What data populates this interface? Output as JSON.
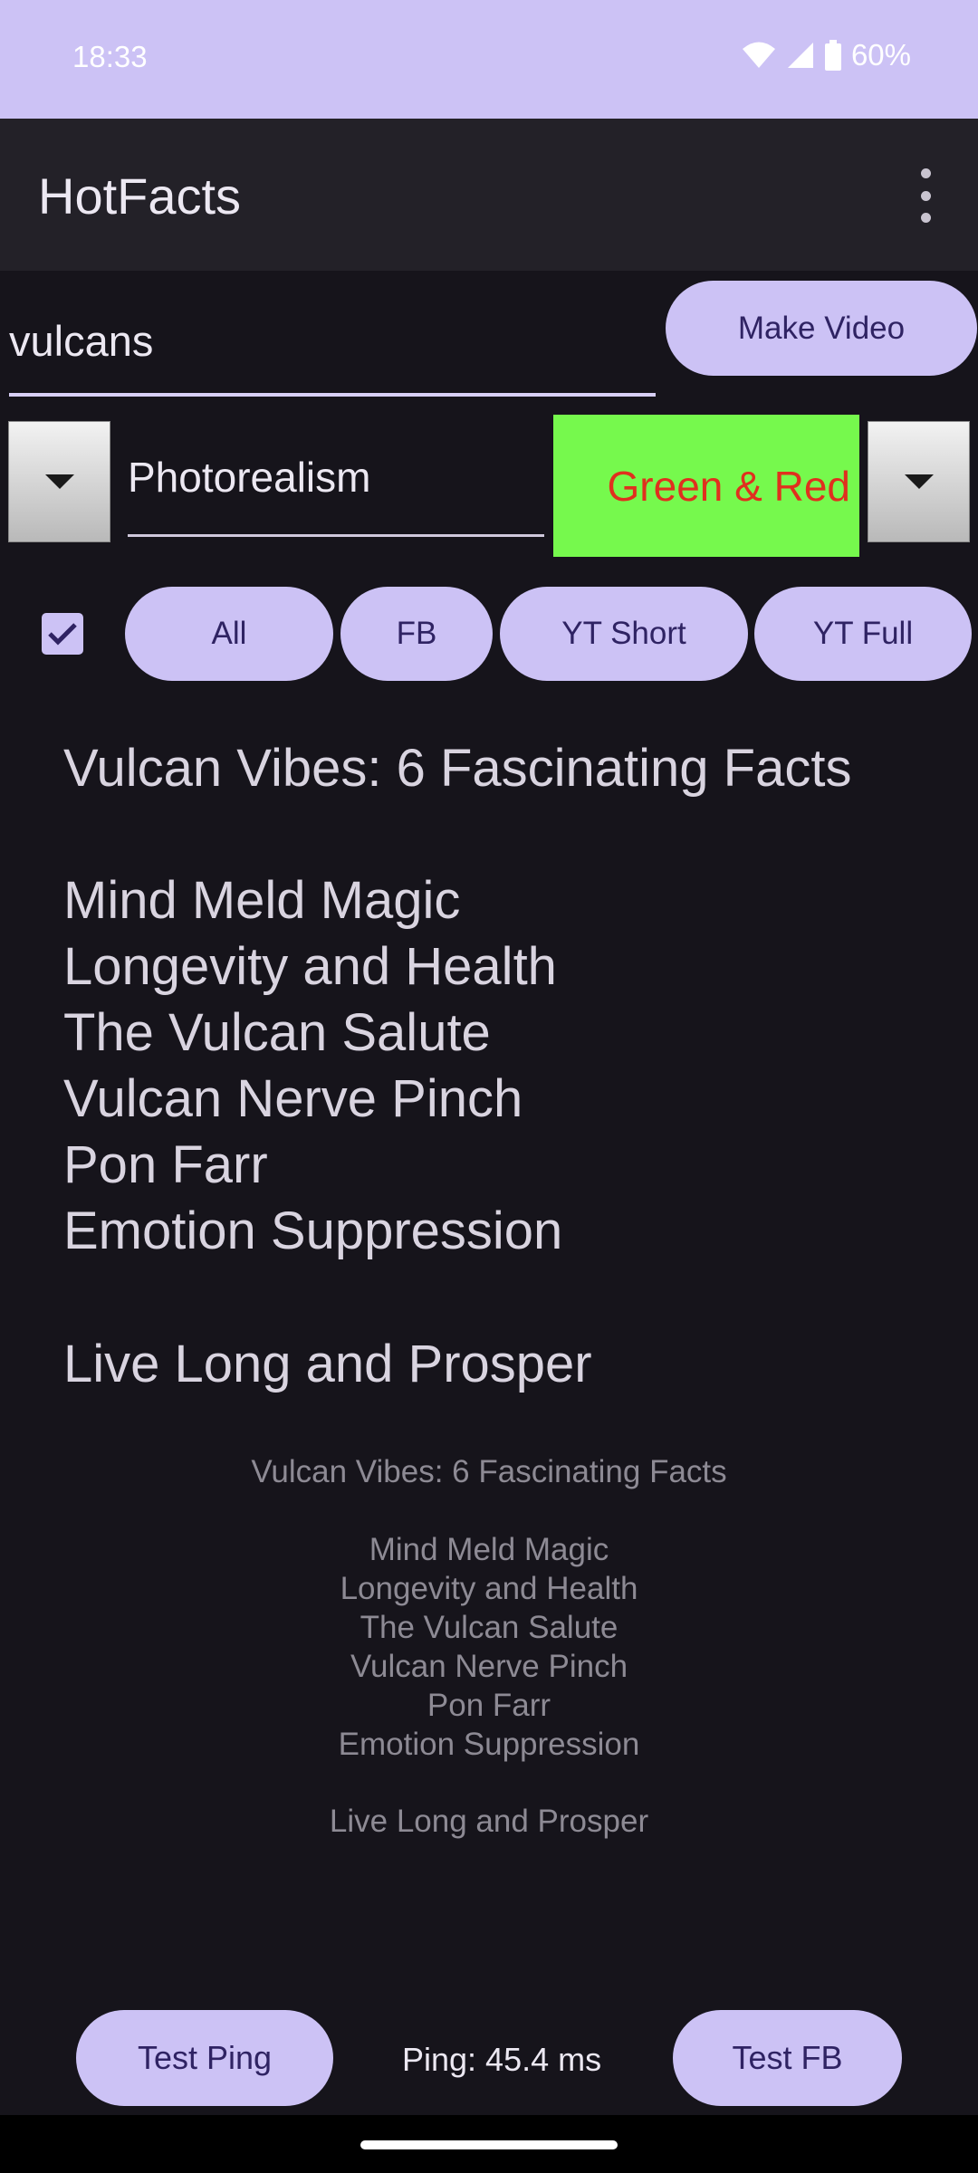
{
  "status_bar": {
    "time": "18:33",
    "battery": "60%"
  },
  "app_bar": {
    "title": "HotFacts"
  },
  "search": {
    "value": "vulcans",
    "make_video_label": "Make Video"
  },
  "style": {
    "field_value": "Photorealism",
    "color_scheme": "Green & Red",
    "color_box_bg": "#76f94d",
    "color_box_text": "#e0301e"
  },
  "filters": {
    "all": "All",
    "fb": "FB",
    "yt_short": "YT Short",
    "yt_full": "YT Full",
    "checkbox_checked": true
  },
  "script": {
    "title": "Vulcan Vibes: 6 Fascinating Facts",
    "facts": [
      "Mind Meld Magic",
      "Longevity and Health",
      "The Vulcan Salute",
      "Vulcan Nerve Pinch",
      "Pon Farr",
      "Emotion Suppression"
    ],
    "closing": "Live Long and Prosper"
  },
  "bottom": {
    "test_ping_label": "Test Ping",
    "ping_text": "Ping: 45.4 ms",
    "test_fb_label": "Test FB"
  },
  "colors": {
    "accent": "#ccc2f5",
    "background": "#16141b",
    "appbar": "#232128"
  }
}
